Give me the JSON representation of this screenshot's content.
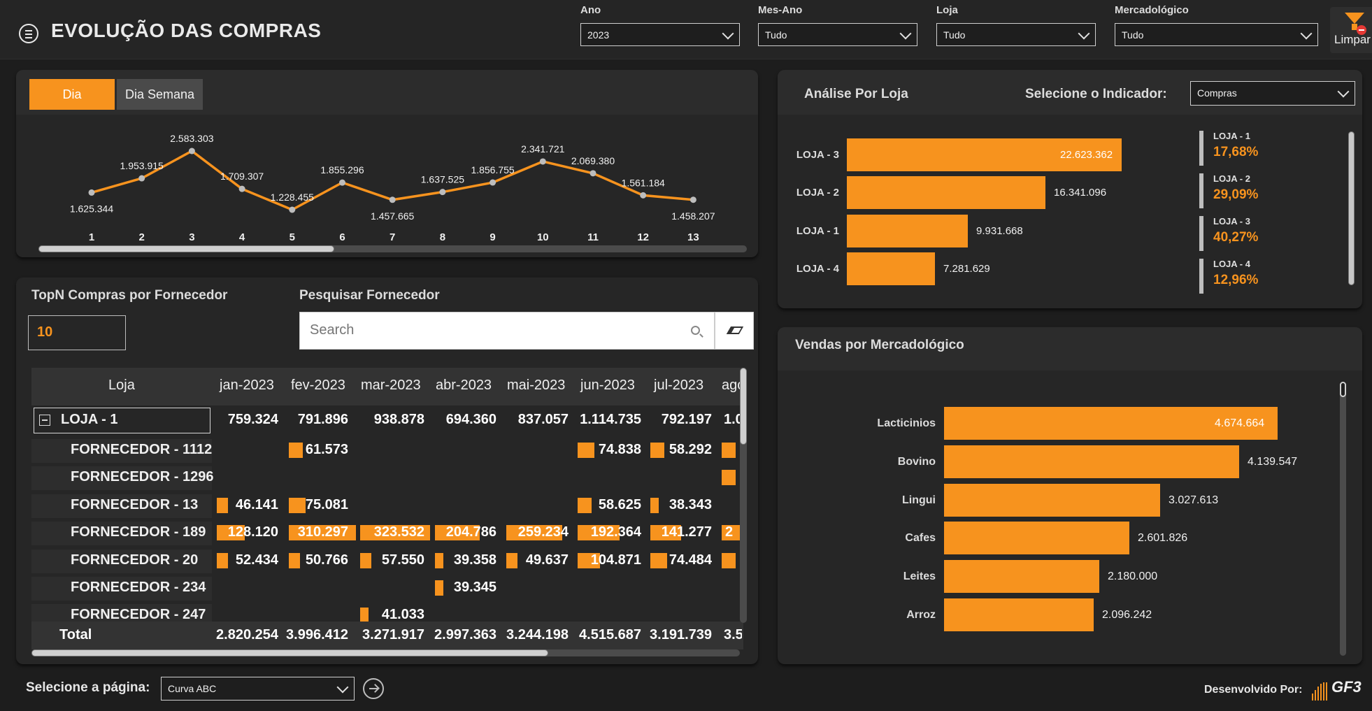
{
  "header": {
    "title": "EVOLUÇÃO DAS COMPRAS",
    "filters": [
      {
        "label": "Ano",
        "value": "2023"
      },
      {
        "label": "Mes-Ano",
        "value": "Tudo"
      },
      {
        "label": "Loja",
        "value": "Tudo"
      },
      {
        "label": "Mercadológico",
        "value": "Tudo"
      }
    ],
    "clear_label": "Limpar"
  },
  "daily_chart": {
    "tabs": [
      "Dia",
      "Dia Semana"
    ],
    "active_tab": "Dia",
    "chart_data": {
      "type": "line",
      "x": [
        "1",
        "2",
        "3",
        "4",
        "5",
        "6",
        "7",
        "8",
        "9",
        "10",
        "11",
        "12",
        "13"
      ],
      "values": [
        1625344,
        1953915,
        2583303,
        1709307,
        1228455,
        1855296,
        1457665,
        1637525,
        1856755,
        2341721,
        2069380,
        1561184,
        1458207
      ],
      "labels": [
        "1.625.344",
        "1.953.915",
        "2.583.303",
        "1.709.307",
        "1.228.455",
        "1.855.296",
        "1.457.665",
        "1.637.525",
        "1.856.755",
        "2.341.721",
        "2.069.380",
        "1.561.184",
        "1.458.207"
      ],
      "color": "#f7931e"
    }
  },
  "supplier": {
    "topn_title": "TopN Compras por Fornecedor",
    "topn_value": "10",
    "search_title": "Pesquisar Fornecedor",
    "search_placeholder": "Search",
    "matrix": {
      "row_header": "Loja",
      "columns": [
        "jan-2023",
        "fev-2023",
        "mar-2023",
        "abr-2023",
        "mai-2023",
        "jun-2023",
        "jul-2023",
        "ago"
      ],
      "group": {
        "label": "LOJA - 1",
        "values": [
          "759.324",
          "791.896",
          "938.878",
          "694.360",
          "837.057",
          "1.114.735",
          "792.197",
          "1.0"
        ]
      },
      "rows": [
        {
          "label": "FORNECEDOR - 1112",
          "values": [
            "",
            "61.573",
            "",
            "",
            "",
            "74.838",
            "58.292",
            ""
          ],
          "bars": [
            0,
            0.05,
            0,
            0,
            0,
            0.06,
            0.05,
            0.05
          ]
        },
        {
          "label": "FORNECEDOR - 1296",
          "values": [
            "",
            "",
            "",
            "",
            "",
            "",
            "",
            ""
          ],
          "bars": [
            0,
            0,
            0,
            0,
            0,
            0,
            0,
            0.05
          ]
        },
        {
          "label": "FORNECEDOR - 13",
          "values": [
            "46.141",
            "75.081",
            "",
            "",
            "",
            "58.625",
            "38.343",
            ""
          ],
          "bars": [
            0.04,
            0.06,
            0,
            0,
            0,
            0.05,
            0.03,
            0
          ]
        },
        {
          "label": "FORNECEDOR - 189",
          "values": [
            "128.120",
            "310.297",
            "323.532",
            "204.786",
            "259.234",
            "192.364",
            "141.277",
            "2"
          ],
          "bars": [
            0.1,
            0.24,
            0.25,
            0.16,
            0.2,
            0.15,
            0.11,
            0.2
          ]
        },
        {
          "label": "FORNECEDOR - 20",
          "values": [
            "52.434",
            "50.766",
            "57.550",
            "39.358",
            "49.637",
            "104.871",
            "74.484",
            ""
          ],
          "bars": [
            0.04,
            0.04,
            0.04,
            0.03,
            0.04,
            0.08,
            0.06,
            0.05
          ]
        },
        {
          "label": "FORNECEDOR - 234",
          "values": [
            "",
            "",
            "",
            "39.345",
            "",
            "",
            "",
            ""
          ],
          "bars": [
            0,
            0,
            0,
            0.03,
            0,
            0,
            0,
            0
          ]
        },
        {
          "label": "FORNECEDOR - 247",
          "values": [
            "",
            "",
            "41.033",
            "",
            "",
            "",
            "",
            ""
          ],
          "bars": [
            0,
            0,
            0.03,
            0,
            0,
            0,
            0,
            0
          ]
        }
      ],
      "total": {
        "label": "Total",
        "values": [
          "2.820.254",
          "3.996.412",
          "3.271.917",
          "2.997.363",
          "3.244.198",
          "4.515.687",
          "3.191.739",
          "3.5"
        ]
      }
    }
  },
  "store_analysis": {
    "title": "Análise Por Loja",
    "indicator_label": "Selecione o Indicador:",
    "indicator_value": "Compras",
    "chart_data": {
      "type": "bar",
      "orientation": "horizontal",
      "categories": [
        "LOJA - 3",
        "LOJA - 2",
        "LOJA - 1",
        "LOJA - 4"
      ],
      "values": [
        22623362,
        16341096,
        9931668,
        7281629
      ],
      "labels": [
        "22.623.362",
        "16.341.096",
        "9.931.668",
        "7.281.629"
      ],
      "color": "#f7931e"
    },
    "kpis": [
      {
        "name": "LOJA - 1",
        "pct": "17,68%"
      },
      {
        "name": "LOJA - 2",
        "pct": "29,09%"
      },
      {
        "name": "LOJA - 3",
        "pct": "40,27%"
      },
      {
        "name": "LOJA - 4",
        "pct": "12,96%"
      }
    ]
  },
  "merch": {
    "title": "Vendas por Mercadológico",
    "chart_data": {
      "type": "bar",
      "orientation": "horizontal",
      "categories": [
        "Lacticinios",
        "Bovino",
        "Lingui",
        "Cafes",
        "Leites",
        "Arroz"
      ],
      "values": [
        4674664,
        4139547,
        3027613,
        2601826,
        2180000,
        2096242
      ],
      "labels": [
        "4.674.664",
        "4.139.547",
        "3.027.613",
        "2.601.826",
        "2.180.000",
        "2.096.242"
      ],
      "color": "#f7931e"
    }
  },
  "footer": {
    "page_select_label": "Selecione a página:",
    "page_select_value": "Curva ABC",
    "developer_label": "Desenvolvido Por:",
    "brand": "GF3"
  }
}
